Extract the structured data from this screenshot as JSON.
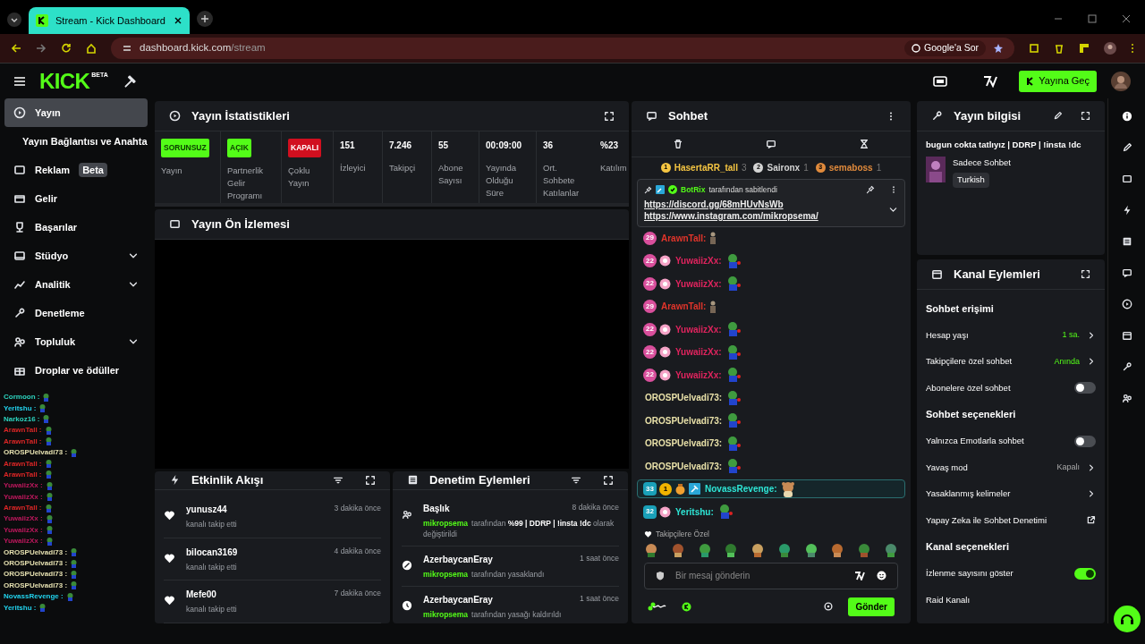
{
  "browser": {
    "tab_title": "Stream - Kick Dashboard",
    "url_host": "dashboard.kick.com",
    "url_path": "/stream",
    "ask_google": "Google'a Sor"
  },
  "topbar": {
    "logo": "KICK",
    "logo_tag": "BETA",
    "go_live": "Yayına Geç"
  },
  "sidebar": {
    "items": [
      {
        "label": "Yayın",
        "selected": true,
        "expandable": false
      },
      {
        "label": "Yayın Bağlantısı ve Anahta",
        "selected": false,
        "expandable": false
      },
      {
        "label": "Reklam",
        "selected": false,
        "expandable": false,
        "badge": "Beta"
      },
      {
        "label": "Gelir",
        "selected": false,
        "expandable": false
      },
      {
        "label": "Başarılar",
        "selected": false,
        "expandable": false
      },
      {
        "label": "Stüdyo",
        "selected": false,
        "expandable": true
      },
      {
        "label": "Analitik",
        "selected": false,
        "expandable": true
      },
      {
        "label": "Denetleme",
        "selected": false,
        "expandable": false
      },
      {
        "label": "Topluluk",
        "selected": false,
        "expandable": true
      },
      {
        "label": "Droplar ve ödüller",
        "selected": false,
        "expandable": false
      }
    ]
  },
  "chat_overlay": [
    {
      "user": "Cormoon :",
      "color": "#2dd4bf"
    },
    {
      "user": "Yeritshu :",
      "color": "#22d3ee"
    },
    {
      "user": "Narkoz16 :",
      "color": "#2dd4bf"
    },
    {
      "user": "ArawnTall :",
      "color": "#dc2626"
    },
    {
      "user": "ArawnTall :",
      "color": "#dc2626"
    },
    {
      "user": "OROSPUelvadi73 :",
      "color": "#e5e0b0"
    },
    {
      "user": "ArawnTall :",
      "color": "#dc2626"
    },
    {
      "user": "ArawnTall :",
      "color": "#dc2626"
    },
    {
      "user": "YuwaiizXx :",
      "color": "#be185d"
    },
    {
      "user": "YuwaiizXx :",
      "color": "#be185d"
    },
    {
      "user": "ArawnTall :",
      "color": "#dc2626"
    },
    {
      "user": "YuwaiizXx :",
      "color": "#be185d"
    },
    {
      "user": "YuwaiizXx :",
      "color": "#be185d"
    },
    {
      "user": "YuwaiizXx :",
      "color": "#be185d"
    },
    {
      "user": "OROSPUelvadi73 :",
      "color": "#e5e0b0"
    },
    {
      "user": "OROSPUelvadi73 :",
      "color": "#e5e0b0"
    },
    {
      "user": "OROSPUelvadi73 :",
      "color": "#e5e0b0"
    },
    {
      "user": "OROSPUelvadi73 :",
      "color": "#e5e0b0"
    },
    {
      "user": "NovassRevenge :",
      "color": "#22d3ee"
    },
    {
      "user": "Yeritshu :",
      "color": "#22d3ee"
    }
  ],
  "stats": {
    "title": "Yayın İstatistikleri",
    "cells": [
      {
        "kind": "badge",
        "value": "SORUNSUZ",
        "color": "#53fc18",
        "label": "Yayın"
      },
      {
        "kind": "badge",
        "value": "AÇIK",
        "color": "#53fc18",
        "label": "Partnerlik Gelir Programı"
      },
      {
        "kind": "badge",
        "value": "KAPALI",
        "color": "#d10f1f",
        "label": "Çoklu Yayın"
      },
      {
        "kind": "number",
        "value": "151",
        "label": "İzleyici"
      },
      {
        "kind": "number",
        "value": "7.246",
        "label": "Takipçi"
      },
      {
        "kind": "number",
        "value": "55",
        "label": "Abone Sayısı"
      },
      {
        "kind": "number",
        "value": "00:09:00",
        "label": "Yayında Olduğu Süre"
      },
      {
        "kind": "number",
        "value": "36",
        "label": "Ort. Sohbete Katılanlar"
      },
      {
        "kind": "number",
        "value": "%23",
        "label": "Katılım"
      }
    ]
  },
  "preview": {
    "title": "Yayın Ön İzlemesi"
  },
  "activity": {
    "title": "Etkinlik Akışı",
    "items": [
      {
        "user": "yunusz44",
        "action": "kanalı takip etti",
        "time": "3 dakika önce"
      },
      {
        "user": "bilocan3169",
        "action": "kanalı takip etti",
        "time": "4 dakika önce"
      },
      {
        "user": "Mefe00",
        "action": "kanalı takip etti",
        "time": "7 dakika önce"
      }
    ]
  },
  "moderation": {
    "title": "Denetim Eylemleri",
    "items": [
      {
        "kind": "title",
        "subject": "Başlık",
        "actor": "mikropsema",
        "text": "tarafından **%99 | DDRP | !insta !dc** olarak değiştirildi",
        "time": "8 dakika önce"
      },
      {
        "kind": "ban",
        "subject": "AzerbaycanEray",
        "actor": "mikropsema",
        "text": "tarafından yasaklandı",
        "time": "1 saat önce"
      },
      {
        "kind": "unban",
        "subject": "AzerbaycanEray",
        "actor": "mikropsema",
        "text": "tarafından yasağı kaldırıldı",
        "time": "1 saat önce"
      }
    ]
  },
  "chat": {
    "title": "Sohbet",
    "leaders": [
      {
        "rank": "1",
        "user": "HasertaRR_tall",
        "count": "3",
        "color": "#f5c542"
      },
      {
        "rank": "2",
        "user": "Saironx",
        "count": "1",
        "color": "#d4d4d4"
      },
      {
        "rank": "3",
        "user": "semaboss",
        "count": "1",
        "color": "#e08a3c"
      }
    ],
    "pinned": {
      "by": "BotRix",
      "note": "tarafından sabitlendi",
      "links": [
        "https://discord.gg/68mHUvNsWb",
        "https://www.instagram.com/mikropsema/"
      ]
    },
    "messages": [
      {
        "user": "ArawnTall:",
        "color": "#e2352b",
        "badges": [
          {
            "kind": "sub",
            "text": "29"
          }
        ],
        "kind": "figure",
        "highlighted": false
      },
      {
        "user": "YuwaiizXx:",
        "color": "#e0245e",
        "badges": [
          {
            "kind": "sub",
            "text": "22"
          },
          {
            "kind": "flower"
          }
        ],
        "kind": "frog",
        "highlighted": false
      },
      {
        "user": "YuwaiizXx:",
        "color": "#e0245e",
        "badges": [
          {
            "kind": "sub",
            "text": "22"
          },
          {
            "kind": "flower"
          }
        ],
        "kind": "frog",
        "highlighted": false
      },
      {
        "user": "ArawnTall:",
        "color": "#e2352b",
        "badges": [
          {
            "kind": "sub",
            "text": "29"
          }
        ],
        "kind": "figure",
        "highlighted": false
      },
      {
        "user": "YuwaiizXx:",
        "color": "#e0245e",
        "badges": [
          {
            "kind": "sub",
            "text": "22"
          },
          {
            "kind": "flower"
          }
        ],
        "kind": "frog",
        "highlighted": false
      },
      {
        "user": "YuwaiizXx:",
        "color": "#e0245e",
        "badges": [
          {
            "kind": "sub",
            "text": "22"
          },
          {
            "kind": "flower"
          }
        ],
        "kind": "frog",
        "highlighted": false
      },
      {
        "user": "YuwaiizXx:",
        "color": "#e0245e",
        "badges": [
          {
            "kind": "sub",
            "text": "22"
          },
          {
            "kind": "flower"
          }
        ],
        "kind": "frog",
        "highlighted": false
      },
      {
        "user": "OROSPUelvadi73:",
        "color": "#e8e0a8",
        "kind": "frog",
        "highlighted": false
      },
      {
        "user": "OROSPUelvadi73:",
        "color": "#e8e0a8",
        "kind": "frog",
        "highlighted": false
      },
      {
        "user": "OROSPUelvadi73:",
        "color": "#e8e0a8",
        "kind": "frog",
        "highlighted": false
      },
      {
        "user": "OROSPUelvadi73:",
        "color": "#e8e0a8",
        "kind": "frog",
        "highlighted": false
      },
      {
        "user": "NovassRevenge:",
        "color": "#2ee6d6",
        "badges": [
          {
            "kind": "shield",
            "text": "33"
          },
          {
            "kind": "coin",
            "text": "1"
          },
          {
            "kind": "pot"
          },
          {
            "kind": "hammer"
          }
        ],
        "kind": "bear",
        "highlighted": true
      },
      {
        "user": "Yeritshu:",
        "color": "#2ee6d6",
        "badges": [
          {
            "kind": "shield",
            "text": "32"
          },
          {
            "kind": "flower"
          }
        ],
        "kind": "frog",
        "highlighted": false
      }
    ],
    "emote_section": "Takipçilere Özel",
    "input_placeholder": "Bir mesaj gönderin",
    "send": "Gönder"
  },
  "stream_info": {
    "title": "Yayın bilgisi",
    "stream_title": "bugun cokta tatlıyız | DDRP | !insta !dc",
    "category": "Sadece Sohbet",
    "tag": "Turkish"
  },
  "channel_actions": {
    "title": "Kanal Eylemleri",
    "rows": [
      {
        "kind": "heading",
        "label": "Sohbet erişimi"
      },
      {
        "kind": "link",
        "label": "Hesap yaşı",
        "value": "1 sa.",
        "active": true
      },
      {
        "kind": "link",
        "label": "Takipçilere özel sohbet",
        "value": "Anında",
        "active": true
      },
      {
        "kind": "toggle",
        "label": "Abonelere özel sohbet",
        "on": false
      },
      {
        "kind": "heading",
        "label": "Sohbet seçenekleri"
      },
      {
        "kind": "toggle",
        "label": "Yalnızca Emotlarla sohbet",
        "on": false
      },
      {
        "kind": "link",
        "label": "Yavaş mod",
        "value": "Kapalı",
        "active": false
      },
      {
        "kind": "link",
        "label": "Yasaklanmış kelimeler"
      },
      {
        "kind": "external",
        "label": "Yapay Zeka ile Sohbet Denetimi"
      },
      {
        "kind": "heading",
        "label": "Kanal seçenekleri"
      },
      {
        "kind": "toggle",
        "label": "İzlenme sayısını göster",
        "on": true
      },
      {
        "kind": "plain",
        "label": "Raid Kanalı"
      }
    ]
  }
}
